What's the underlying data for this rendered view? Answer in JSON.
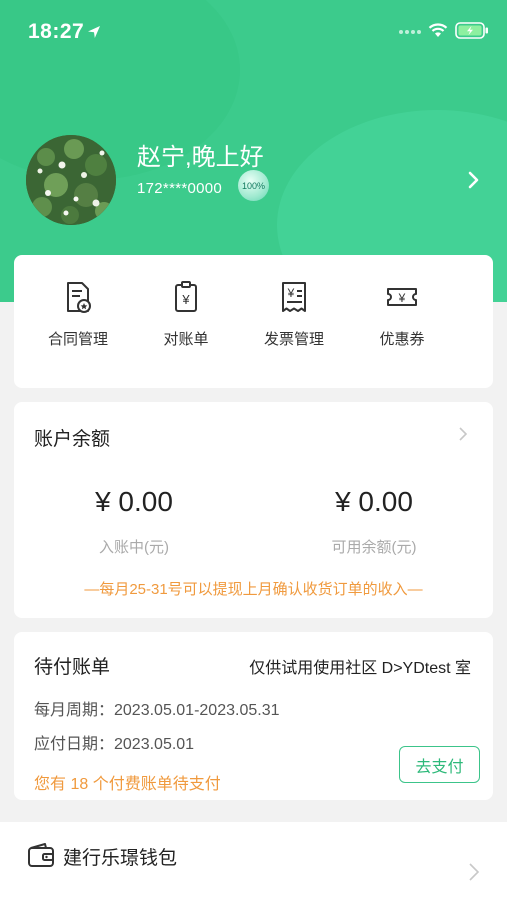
{
  "status_bar": {
    "time": "18:27"
  },
  "profile": {
    "greeting": "赵宁,晚上好",
    "phone": "172****0000",
    "completion": "100%"
  },
  "quick_actions": [
    {
      "label": "合同管理",
      "icon": "contract-icon"
    },
    {
      "label": "对账单",
      "icon": "statement-icon"
    },
    {
      "label": "发票管理",
      "icon": "invoice-icon"
    },
    {
      "label": "优惠券",
      "icon": "coupon-icon"
    }
  ],
  "balance": {
    "title": "账户余额",
    "pending_amount": "¥ 0.00",
    "pending_label": "入账中(元)",
    "available_amount": "¥ 0.00",
    "available_label": "可用余额(元)",
    "notice": "—每月25-31号可以提现上月确认收货订单的收入—"
  },
  "bill": {
    "title": "待付账单",
    "community": "仅供试用使用社区 D>YDtest 室",
    "period": "每月周期：2023.05.01-2023.05.31",
    "due_date": "应付日期：2023.05.01",
    "pending_notice": "您有 18 个付费账单待支付",
    "pay_label": "去支付"
  },
  "wallet": {
    "name": "建行乐璟钱包"
  },
  "colors": {
    "brand": "#3ccb8c",
    "accent": "#f09a3e",
    "button": "#2eb97a"
  }
}
